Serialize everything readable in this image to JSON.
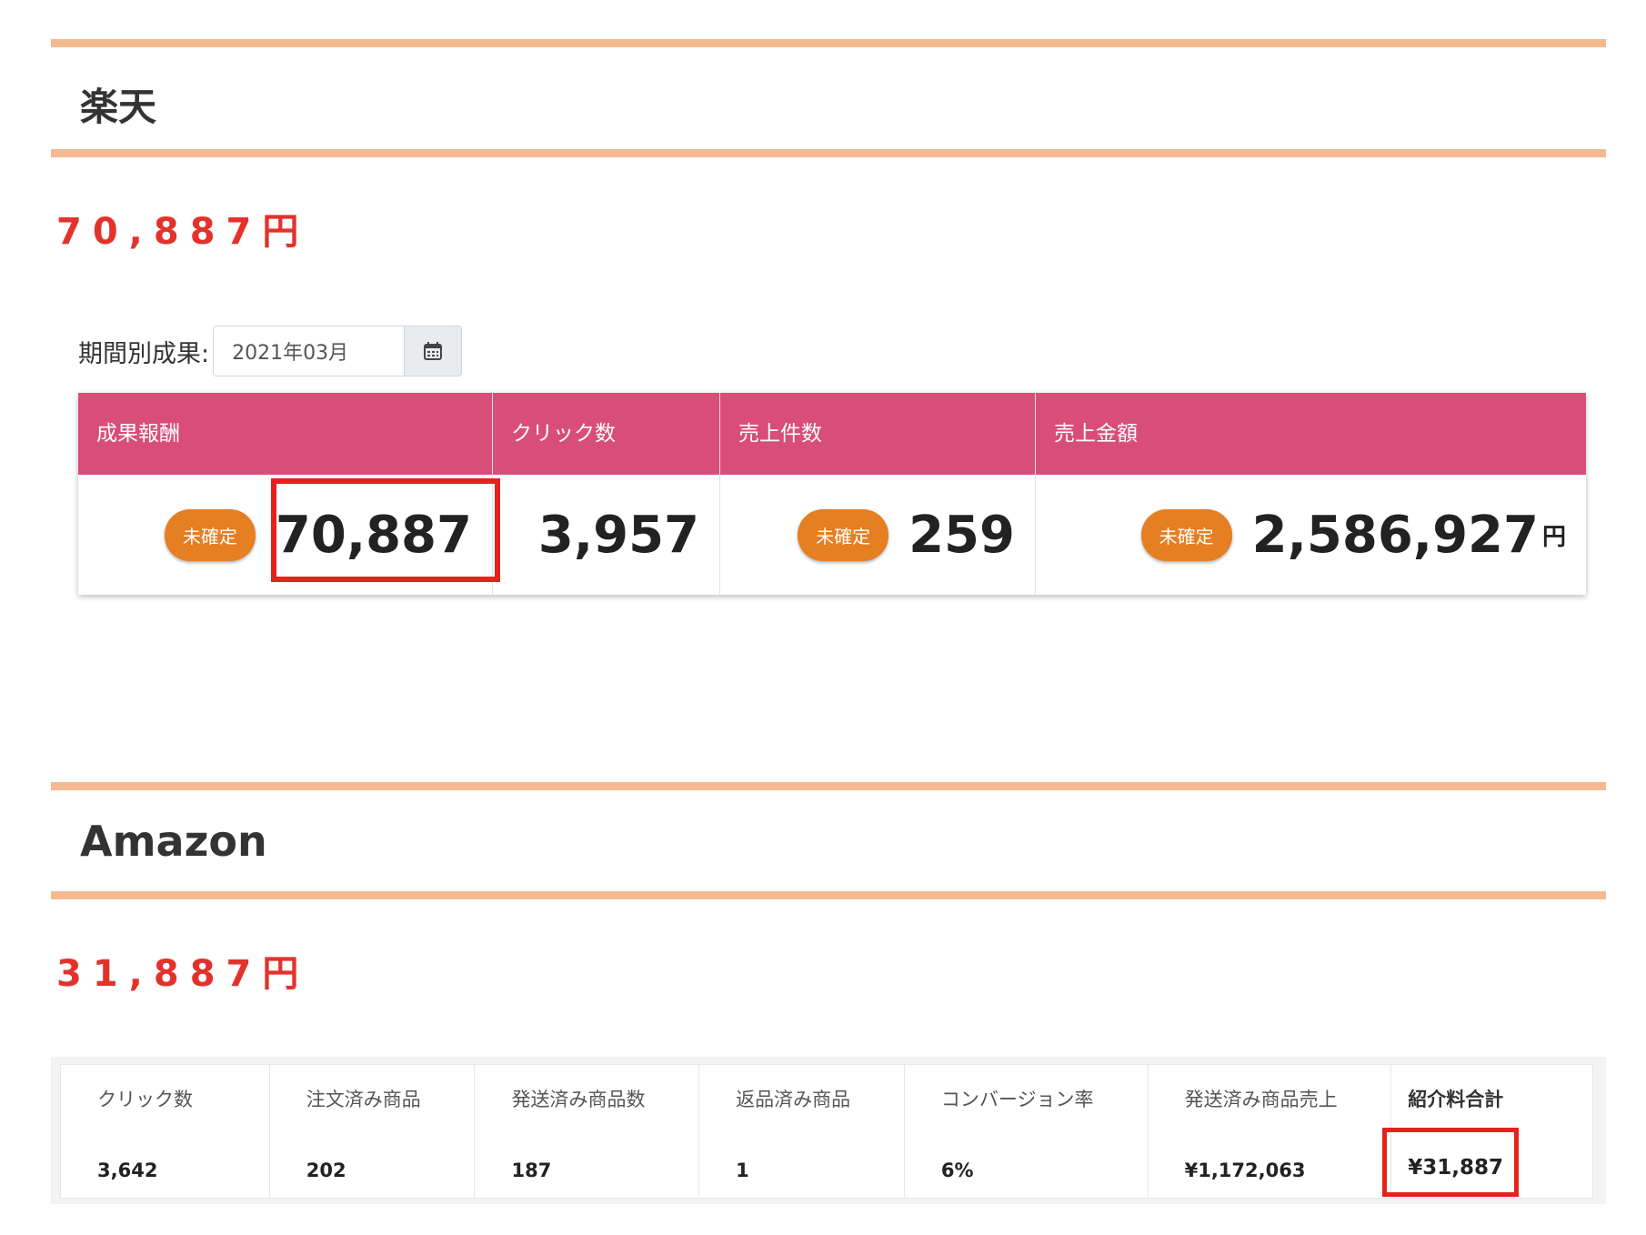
{
  "rakuten": {
    "title": "楽天",
    "amount": "70,887円",
    "period_label": "期間別成果:",
    "period_value": "2021年03月",
    "columns": [
      {
        "header": "成果報酬",
        "badge": "未確定",
        "value": "70,887",
        "unit": ""
      },
      {
        "header": "クリック数",
        "badge": "",
        "value": "3,957",
        "unit": ""
      },
      {
        "header": "売上件数",
        "badge": "未確定",
        "value": "259",
        "unit": ""
      },
      {
        "header": "売上金額",
        "badge": "未確定",
        "value": "2,586,927",
        "unit": "円"
      }
    ]
  },
  "amazon": {
    "title": "Amazon",
    "amount": "31,887円",
    "columns": [
      {
        "label": "クリック数",
        "value": "3,642"
      },
      {
        "label": "注文済み商品",
        "value": "202"
      },
      {
        "label": "発送済み商品数",
        "value": "187"
      },
      {
        "label": "返品済み商品",
        "value": "1"
      },
      {
        "label": "コンバージョン率",
        "value": "6%"
      },
      {
        "label": "発送済み商品売上",
        "value": "¥1,172,063"
      },
      {
        "label": "紹介料合計",
        "value": "¥31,887"
      }
    ]
  },
  "icons": {
    "calendar": "calendar-icon"
  },
  "colors": {
    "accent_rule": "#f4b990",
    "header_pink": "#d94d79",
    "badge_orange": "#e67e22",
    "highlight_red": "#e3231c",
    "amount_red": "#e3322b"
  }
}
